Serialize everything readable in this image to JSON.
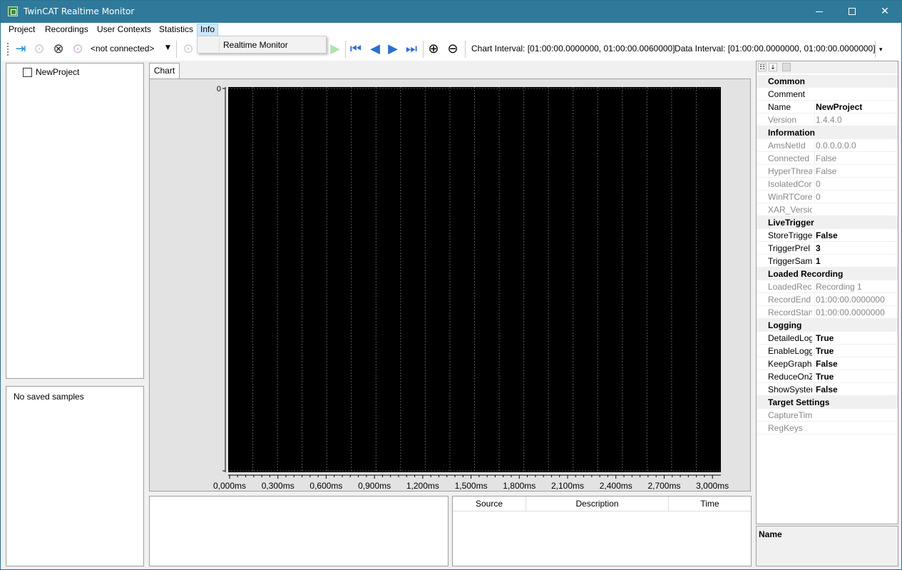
{
  "window": {
    "title": "TwinCAT Realtime Monitor"
  },
  "menu": {
    "items": [
      "Project",
      "Recordings",
      "User Contexts",
      "Statistics",
      "Info"
    ],
    "active": "Info",
    "dropdown": {
      "items": [
        "Realtime Monitor"
      ]
    }
  },
  "toolbar": {
    "target_combo": "<not connected>",
    "chart_interval": "Chart Interval: [01:00:00.0000000, 01:00:00.0060000]",
    "data_interval": "Data Interval: [01:00:00.0000000, 01:00:00.0000000]"
  },
  "tree": {
    "root": "NewProject"
  },
  "samples": {
    "empty_text": "No saved samples"
  },
  "chart": {
    "tab_label": "Chart"
  },
  "chart_data": {
    "type": "line",
    "series": [],
    "x_ticks": [
      "0,000ms",
      "0,300ms",
      "0,600ms",
      "0,900ms",
      "1,200ms",
      "1,500ms",
      "1,800ms",
      "2,100ms",
      "2,400ms",
      "2,700ms",
      "3,000ms"
    ],
    "xlim": [
      0,
      3
    ],
    "y_ticks": [
      "0"
    ],
    "background": "#000000",
    "grid": true
  },
  "log_table": {
    "columns": [
      "Source",
      "Description",
      "Time"
    ]
  },
  "properties": {
    "groups": [
      {
        "name": "Common",
        "rows": [
          {
            "name": "Comment",
            "value": "",
            "style": "normal"
          },
          {
            "name": "Name",
            "value": "NewProject",
            "style": "bold"
          },
          {
            "name": "Version",
            "value": "1.4.4.0",
            "style": "ro"
          }
        ]
      },
      {
        "name": "Information",
        "rows": [
          {
            "name": "AmsNetId",
            "value": "0.0.0.0.0.0",
            "style": "ro"
          },
          {
            "name": "Connected",
            "value": "False",
            "style": "ro"
          },
          {
            "name": "HyperThrea",
            "value": "False",
            "style": "ro"
          },
          {
            "name": "IsolatedCor",
            "value": "0",
            "style": "ro"
          },
          {
            "name": "WinRTCores",
            "value": "0",
            "style": "ro"
          },
          {
            "name": "XAR_Versio",
            "value": "",
            "style": "ro"
          }
        ]
      },
      {
        "name": "LiveTrigger",
        "rows": [
          {
            "name": "StoreTrigge",
            "value": "False",
            "style": "bold"
          },
          {
            "name": "TriggerPrel",
            "value": "3",
            "style": "bold"
          },
          {
            "name": "TriggerSam",
            "value": "1",
            "style": "bold"
          }
        ]
      },
      {
        "name": "Loaded Recording",
        "rows": [
          {
            "name": "LoadedReco",
            "value": "Recording 1",
            "style": "ro"
          },
          {
            "name": "RecordEnd",
            "value": "01:00:00.0000000",
            "style": "ro"
          },
          {
            "name": "RecordStart",
            "value": "01:00:00.0000000",
            "style": "ro"
          }
        ]
      },
      {
        "name": "Logging",
        "rows": [
          {
            "name": "DetailedLog",
            "value": "True",
            "style": "bold"
          },
          {
            "name": "EnableLogg",
            "value": "True",
            "style": "bold"
          },
          {
            "name": "KeepGraph(",
            "value": "False",
            "style": "bold"
          },
          {
            "name": "ReduceOnZ",
            "value": "True",
            "style": "bold"
          },
          {
            "name": "ShowSyster",
            "value": "False",
            "style": "bold"
          }
        ]
      },
      {
        "name": "Target Settings",
        "rows": [
          {
            "name": "CaptureTim",
            "value": "",
            "style": "ro"
          },
          {
            "name": "RegKeys",
            "value": "",
            "style": "ro"
          }
        ]
      }
    ],
    "description_title": "Name"
  }
}
